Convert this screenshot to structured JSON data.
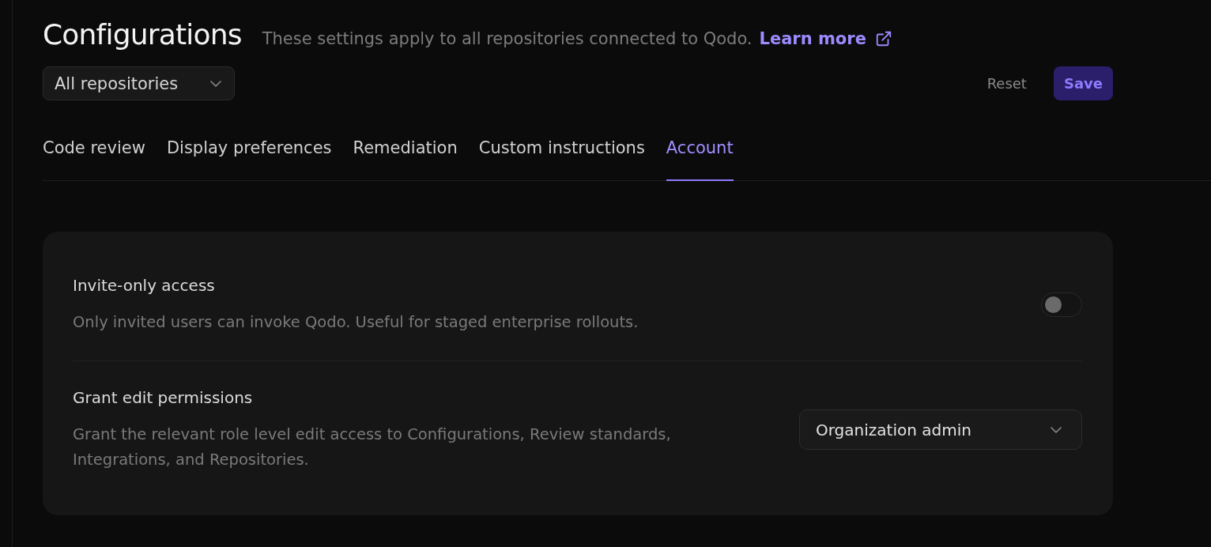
{
  "header": {
    "title": "Configurations",
    "description": "These settings apply to all repositories connected to Qodo.",
    "link": "Learn more"
  },
  "repository_select": {
    "value": "All repositories"
  },
  "actions": [
    {
      "label": "Reset",
      "kind": "secondary"
    },
    {
      "label": "Save",
      "kind": "primary"
    }
  ],
  "tabs": [
    {
      "label": "Code review",
      "selected": false
    },
    {
      "label": "Display preferences",
      "selected": false
    },
    {
      "label": "Remediation",
      "selected": false
    },
    {
      "label": "Custom instructions",
      "selected": false
    },
    {
      "label": "Account",
      "selected": true
    }
  ],
  "settings": [
    {
      "kind": "toggle",
      "title": "Invite-only access",
      "description": "Only invited users can invoke Qodo. Useful for staged enterprise rollouts.",
      "on": false
    },
    {
      "kind": "select",
      "title": "Grant edit permissions",
      "description": "Grant the relevant role level edit access to Configurations, Review standards, Integrations, and Repositories.",
      "value": "Organization admin"
    }
  ]
}
